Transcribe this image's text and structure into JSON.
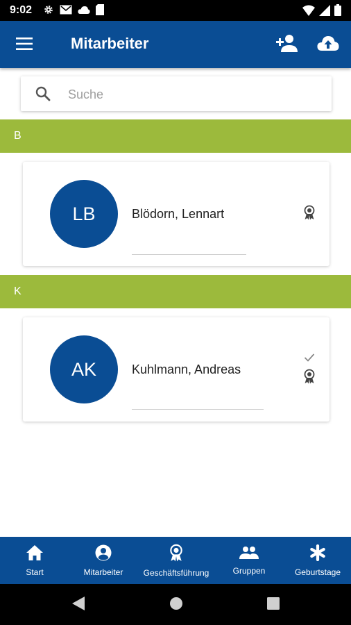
{
  "status_bar": {
    "time": "9:02",
    "left_icons": [
      "settings-icon",
      "gmail-icon",
      "cloud-icon",
      "sd-card-icon"
    ],
    "right_icons": [
      "wifi-icon",
      "signal-icon",
      "battery-icon"
    ]
  },
  "app_bar": {
    "title": "Mitarbeiter",
    "menu_icon": "menu-icon",
    "actions": [
      "add-person-icon",
      "cloud-upload-icon"
    ]
  },
  "search": {
    "placeholder": "Suche",
    "value": ""
  },
  "sections": [
    {
      "letter": "B",
      "employees": [
        {
          "initials": "LB",
          "name": "Blödorn, Lennart",
          "checked": false,
          "badge": "award-icon"
        }
      ]
    },
    {
      "letter": "K",
      "employees": [
        {
          "initials": "AK",
          "name": "Kuhlmann, Andreas",
          "checked": true,
          "badge": "award-icon"
        }
      ]
    }
  ],
  "bottom_nav": {
    "items": [
      {
        "label": "Start",
        "icon": "home-icon"
      },
      {
        "label": "Mitarbeiter",
        "icon": "account-circle-icon"
      },
      {
        "label": "Geschäftsführung",
        "icon": "award-icon"
      },
      {
        "label": "Gruppen",
        "icon": "group-icon"
      },
      {
        "label": "Geburtstage",
        "icon": "asterisk-icon"
      }
    ]
  },
  "system_nav": [
    "back-icon",
    "home-circle-icon",
    "recents-icon"
  ],
  "colors": {
    "primary": "#0a4d94",
    "section_header": "#9cba3c",
    "status_bar": "#000000",
    "background": "#ffffff"
  }
}
